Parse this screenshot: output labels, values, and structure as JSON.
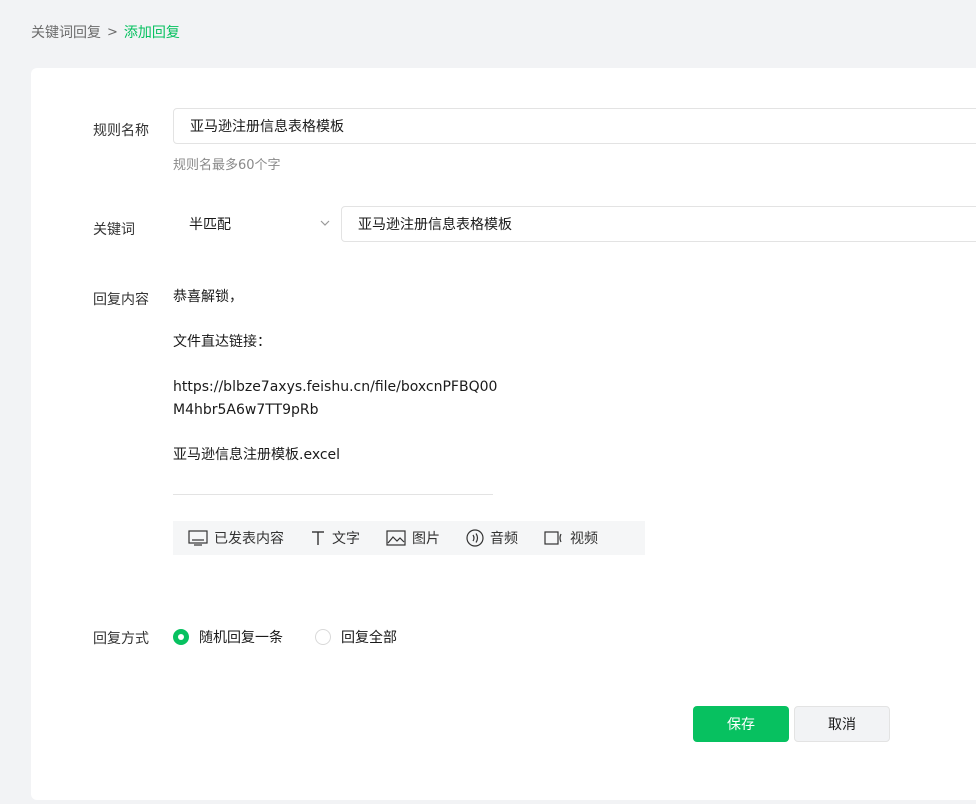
{
  "breadcrumb": {
    "parent": "关键词回复",
    "separator": ">",
    "current": "添加回复"
  },
  "form": {
    "rule_name": {
      "label": "规则名称",
      "value": "亚马逊注册信息表格模板",
      "hint": "规则名最多60个字"
    },
    "keyword": {
      "label": "关键词",
      "match_type": "半匹配",
      "value": "亚马逊注册信息表格模板"
    },
    "reply_content": {
      "label": "回复内容",
      "lines": [
        "恭喜解锁，",
        "",
        "文件直达链接：",
        "",
        "https://blbze7axys.feishu.cn/file/boxcnPFBQ00",
        "M4hbr5A6w7TT9pRb",
        "",
        "亚马逊信息注册模板.excel"
      ],
      "toolbar": [
        {
          "icon": "monitor-icon",
          "label": "已发表内容"
        },
        {
          "icon": "text-icon",
          "label": "文字"
        },
        {
          "icon": "image-icon",
          "label": "图片"
        },
        {
          "icon": "audio-icon",
          "label": "音频"
        },
        {
          "icon": "video-icon",
          "label": "视频"
        }
      ]
    },
    "reply_mode": {
      "label": "回复方式",
      "options": [
        {
          "label": "随机回复一条",
          "selected": true
        },
        {
          "label": "回复全部",
          "selected": false
        }
      ]
    }
  },
  "actions": {
    "save": "保存",
    "cancel": "取消"
  },
  "colors": {
    "accent": "#07c160",
    "background": "#f2f3f5"
  }
}
